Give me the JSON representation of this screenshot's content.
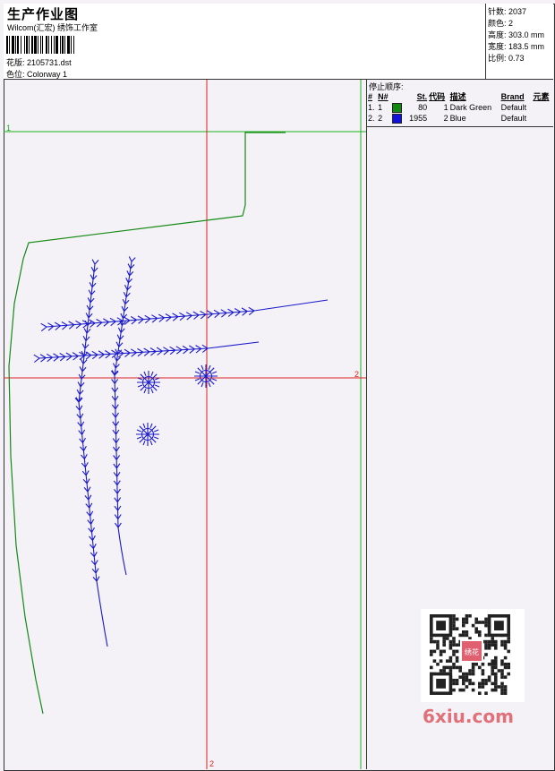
{
  "header": {
    "title": "生产作业图",
    "subtitle": "Wilcom(汇宏) 绣饰工作室",
    "design_label": "花版:",
    "design_value": "2105731.dst",
    "colorway_label": "色位:",
    "colorway_value": "Colorway 1"
  },
  "specs": {
    "stitches": {
      "label": "针数:",
      "value": "2037"
    },
    "colors": {
      "label": "颜色:",
      "value": "2"
    },
    "height": {
      "label": "高度:",
      "value": "303.0 mm"
    },
    "width": {
      "label": "宽度:",
      "value": "183.5 mm"
    },
    "scale": {
      "label": "比例:",
      "value": "0.73"
    }
  },
  "canvas": {
    "marker_left_1": "1",
    "marker_right_2": "2",
    "marker_bottom_2": "2",
    "colors": {
      "grid_red": "#e02020",
      "guide_green": "#20b020",
      "outline_green": "#138a13",
      "stitch_blue": "#1a1acc"
    }
  },
  "stop_sequence": {
    "title": "停止顺序:",
    "columns": [
      "#",
      "N#",
      "",
      "St.",
      "代码",
      "描述",
      "Brand",
      "元素"
    ],
    "rows": [
      {
        "idx": "1.",
        "n": "1",
        "color": "#118811",
        "stitches": "80",
        "code": "1",
        "desc": "Dark Green",
        "brand": "Default",
        "elem": ""
      },
      {
        "idx": "2.",
        "n": "2",
        "color": "#1111dd",
        "stitches": "1955",
        "code": "2",
        "desc": "Blue",
        "brand": "Default",
        "elem": ""
      }
    ]
  },
  "watermark": {
    "text": "6xiu.com",
    "seal_text": "绣花"
  }
}
